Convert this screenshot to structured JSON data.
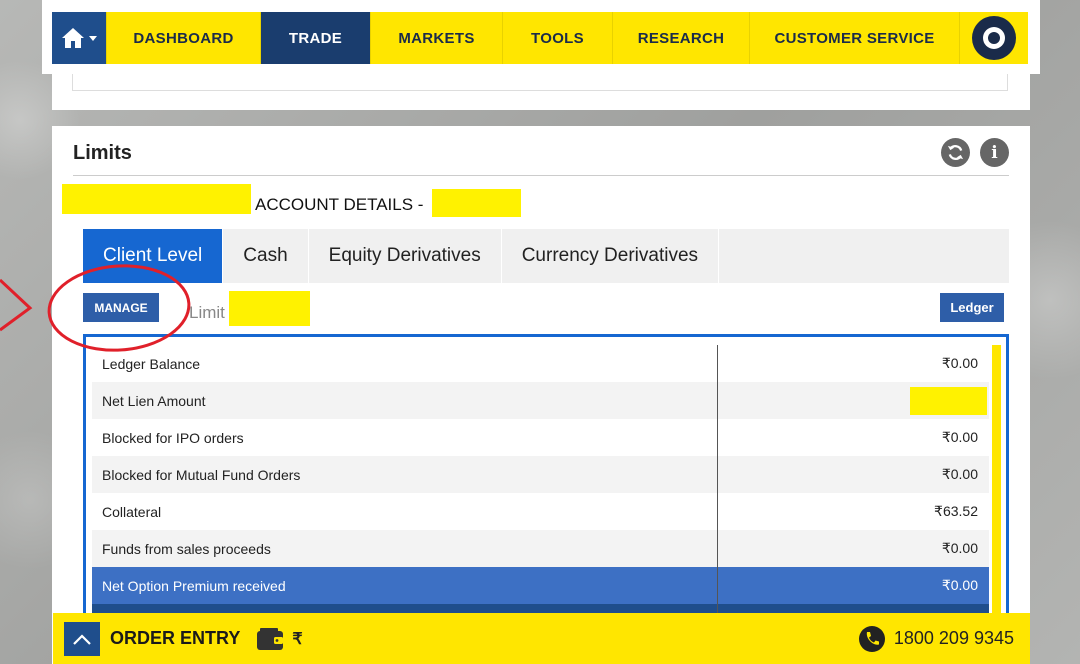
{
  "nav": {
    "items": [
      {
        "label": "DASHBOARD",
        "active": false
      },
      {
        "label": "TRADE",
        "active": true
      },
      {
        "label": "MARKETS",
        "active": false
      },
      {
        "label": "TOOLS",
        "active": false
      },
      {
        "label": "RESEARCH",
        "active": false
      },
      {
        "label": "CUSTOMER SERVICE",
        "active": false
      }
    ],
    "home_icon": "home-icon",
    "logo_icon": "target-logo-icon"
  },
  "panel": {
    "title": "Limits",
    "account_label": "ACCOUNT DETAILS -",
    "refresh_icon": "refresh-icon",
    "info_icon": "info-icon",
    "info_glyph": "i"
  },
  "tabs": [
    {
      "label": "Client Level",
      "active": true
    },
    {
      "label": "Cash",
      "active": false
    },
    {
      "label": "Equity Derivatives",
      "active": false
    },
    {
      "label": "Currency Derivatives",
      "active": false
    }
  ],
  "actions": {
    "manage_label": "MANAGE",
    "limit_text": "Limit",
    "ledger_label": "Ledger"
  },
  "table": {
    "rows": [
      {
        "label": "Ledger Balance",
        "value": "₹0.00"
      },
      {
        "label": "Net Lien Amount",
        "value": ""
      },
      {
        "label": "Blocked for IPO orders",
        "value": "₹0.00"
      },
      {
        "label": "Blocked for Mutual Fund Orders",
        "value": "₹0.00"
      },
      {
        "label": "Collateral",
        "value": "₹63.52"
      },
      {
        "label": "Funds from sales proceeds",
        "value": "₹0.00"
      },
      {
        "label": "Net Option Premium received",
        "value": "₹0.00"
      }
    ]
  },
  "order_bar": {
    "label": "ORDER ENTRY",
    "currency": "₹",
    "phone": "1800 209 9345"
  },
  "colors": {
    "brand_yellow": "#ffe600",
    "brand_navy": "#1a3d6e",
    "accent_blue": "#1667d1",
    "highlight": "#fff200",
    "annotation_red": "#e0202a"
  }
}
